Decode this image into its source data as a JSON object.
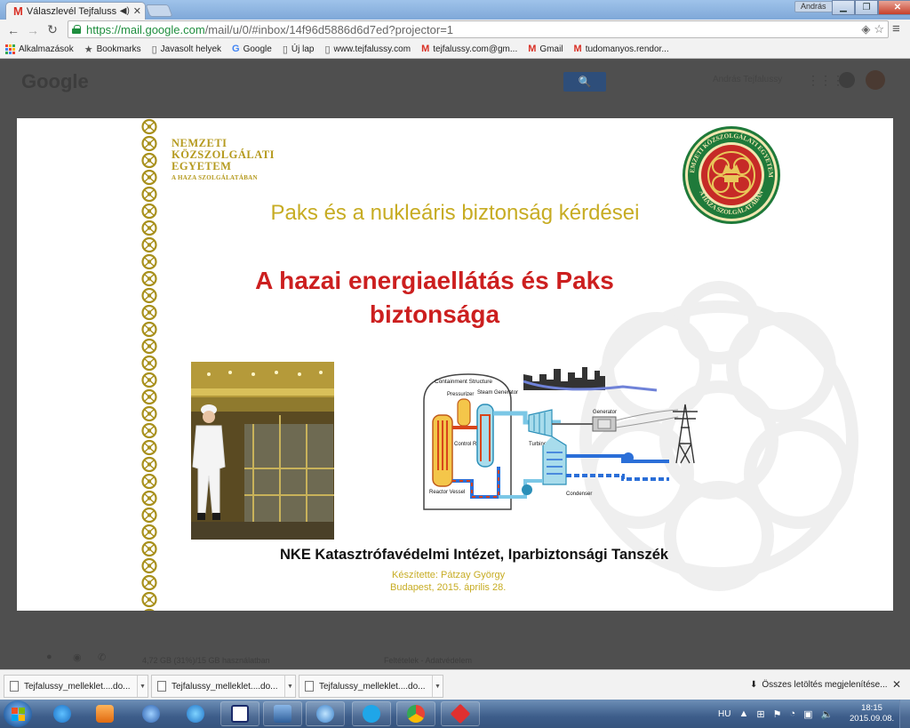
{
  "browser": {
    "tab_title": "Válaszlevél Tejfalussy ú",
    "user_name": "András",
    "url_host": "https://mail.google.com",
    "url_path": "/mail/u/0/#inbox/14f96d5886d6d7ed?projector=1"
  },
  "bookmarks": [
    {
      "label": "Alkalmazások",
      "icon": "apps-grid-icon"
    },
    {
      "label": "Bookmarks",
      "icon": "star-icon"
    },
    {
      "label": "Javasolt helyek",
      "icon": "page-icon"
    },
    {
      "label": "Google",
      "icon": "google-icon"
    },
    {
      "label": "Új lap",
      "icon": "page-icon"
    },
    {
      "label": "www.tejfalussy.com",
      "icon": "page-icon"
    },
    {
      "label": "tejfalussy.com@gm...",
      "icon": "gmail-icon"
    },
    {
      "label": "Gmail",
      "icon": "gmail-icon"
    },
    {
      "label": "tudomanyos.rendor...",
      "icon": "gmail-icon"
    }
  ],
  "gmail": {
    "logo": "Google",
    "user": "András Tejfalussy",
    "storage": "4,72 GB (31%)/15 GB használatban",
    "footer_links": "Feltételek - Adatvédelem"
  },
  "slide": {
    "university_lines": [
      "NEMZETI",
      "KÖZSZOLGÁLATI",
      "EGYETEM"
    ],
    "university_motto": "A HAZA SZOLGÁLATÁBAN",
    "seal_text_top": "NEMZETI KÖZSZOLGÁLATI EGYETEM",
    "seal_text_bottom": "A HAZA SZOLGÁLATÁBAN",
    "subtitle": "Paks és a nukleáris biztonság kérdései",
    "title_line1": "A hazai energiaellátás és Paks",
    "title_line2": "biztonsága",
    "diagram_labels": {
      "containment": "Containment Structure",
      "pressurizer": "Pressurizer",
      "steam_generator": "Steam Generator",
      "control_rods": "Control Rods",
      "reactor_vessel": "Reactor Vessel",
      "turbine": "Turbine",
      "generator": "Generator",
      "condenser": "Condenser"
    },
    "institute": "NKE Katasztrófavédelmi Intézet, Iparbiztonsági Tanszék",
    "author": "Készítette: Pátzay György",
    "place_date": "Budapest, 2015. április 28."
  },
  "downloads": {
    "items": [
      {
        "name": "Tejfalussy_melleklet....do..."
      },
      {
        "name": "Tejfalussy_melleklet....do..."
      },
      {
        "name": "Tejfalussy_melleklet....do..."
      }
    ],
    "show_all": "Összes letöltés megjelenítése..."
  },
  "taskbar": {
    "language": "HU",
    "time": "18:15",
    "date": "2015.09.08."
  },
  "colors": {
    "gold": "#c7ac23",
    "title_red": "#cc1f1f",
    "seal_red": "#c62a27",
    "seal_green": "#1f7a3a"
  }
}
